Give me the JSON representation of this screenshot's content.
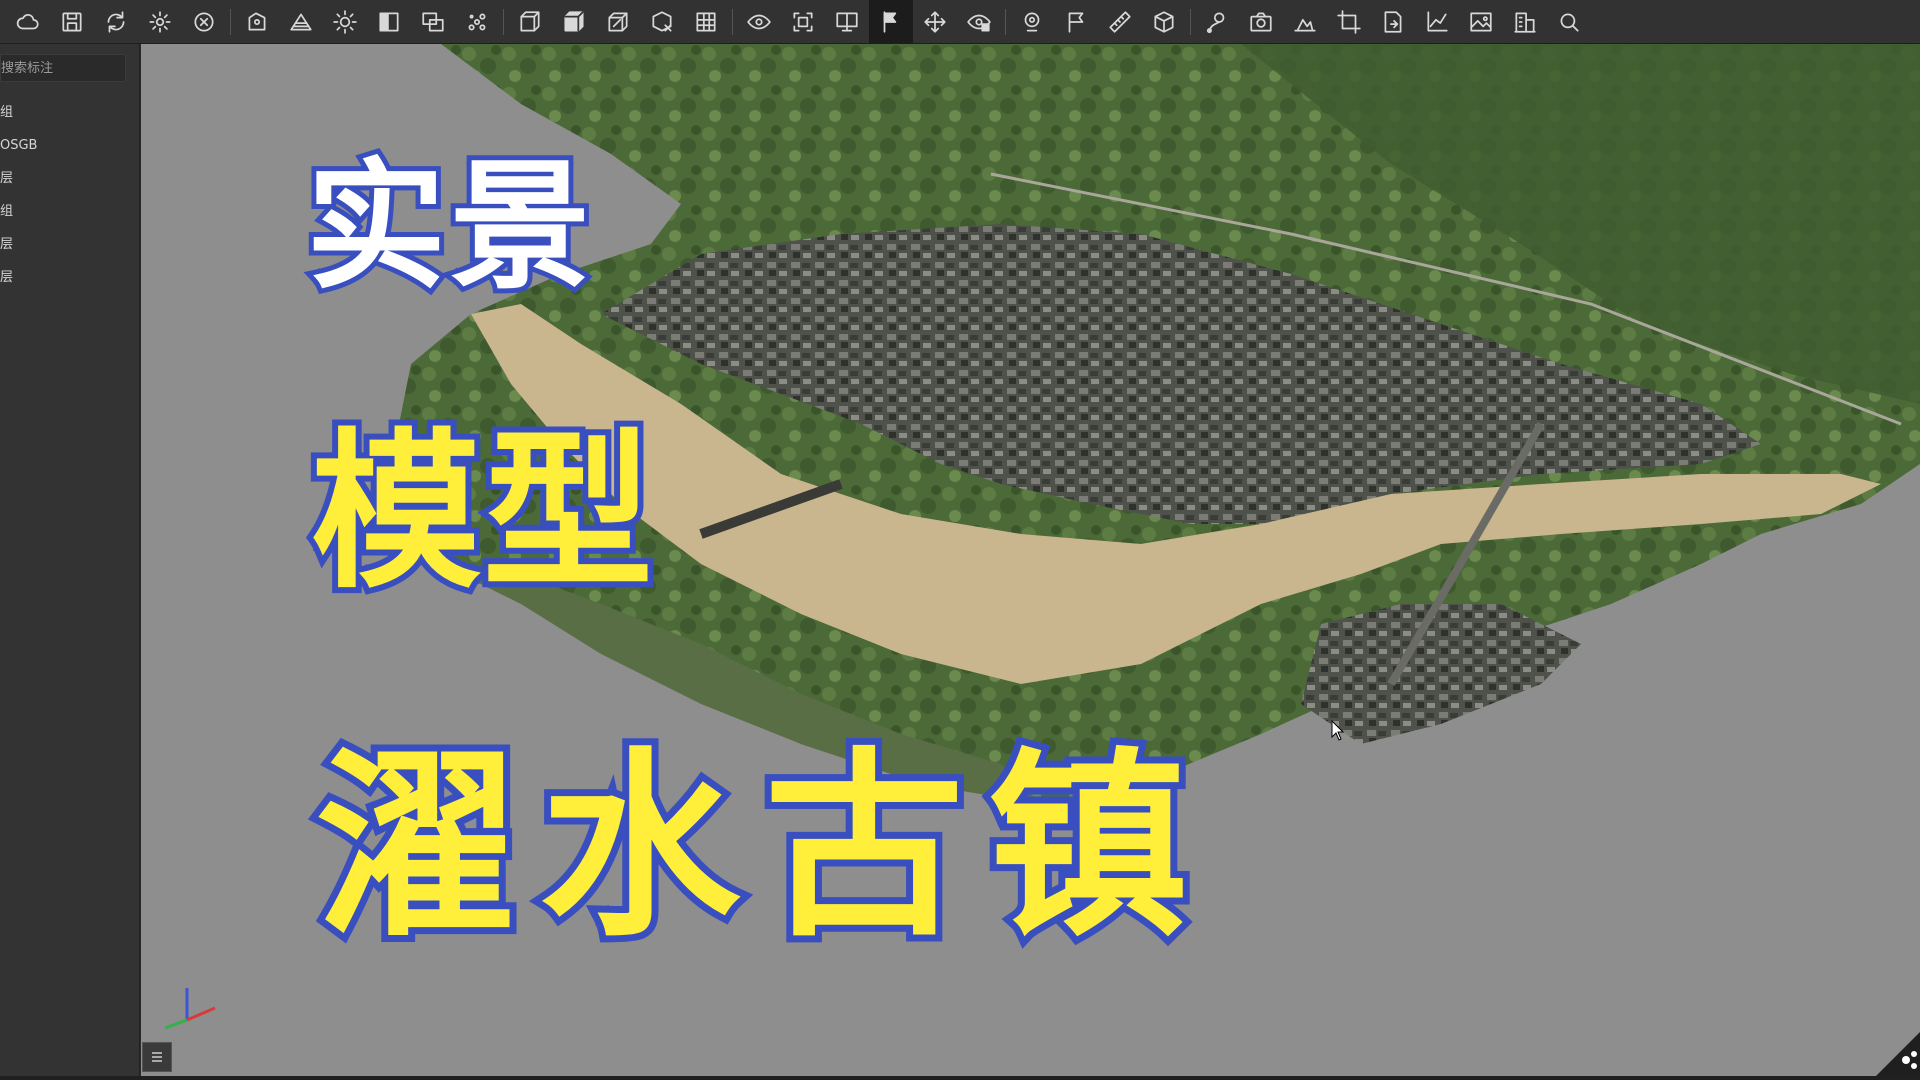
{
  "toolbar": {
    "icons": [
      "cloud-icon",
      "save-icon",
      "refresh-icon",
      "settings-icon",
      "close-circle-icon",
      "shape-select-icon",
      "terrain-icon",
      "sun-icon",
      "panel-icon",
      "layers-icon",
      "scatter-icon",
      "box-wire-icon",
      "cube-solid-icon",
      "cube-edit-icon",
      "cube-delete-icon",
      "grid-icon",
      "eye-rotate-icon",
      "frame-icon",
      "monitor-icon",
      "flag-icon",
      "move-icon",
      "eye-lock-icon",
      "location-icon",
      "waypoint-flag-icon",
      "ruler-icon",
      "cube-3d-icon",
      "route-icon",
      "camera-icon",
      "profile-icon",
      "crop-icon",
      "export-file-icon",
      "chart-icon",
      "image-icon",
      "building-icon",
      "search-icon"
    ],
    "active_index": 19
  },
  "sidebar": {
    "search_placeholder": "搜索标注",
    "items": [
      {
        "label": "组"
      },
      {
        "label": "OSGB"
      },
      {
        "label": "层"
      },
      {
        "label": "组"
      },
      {
        "label": "层"
      },
      {
        "label": "层"
      }
    ]
  },
  "viewport": {
    "title_line1": "实景",
    "title_line2": "模型",
    "title_line3": "濯水古镇",
    "colors": {
      "background": "#8e8e8e",
      "water": "#c9b68f",
      "forest": "#4f6b3a",
      "town": "#55574f",
      "title_outline": "#3a4fbf",
      "title_yellow": "#ffef3a",
      "title_white": "#ffffff"
    }
  }
}
